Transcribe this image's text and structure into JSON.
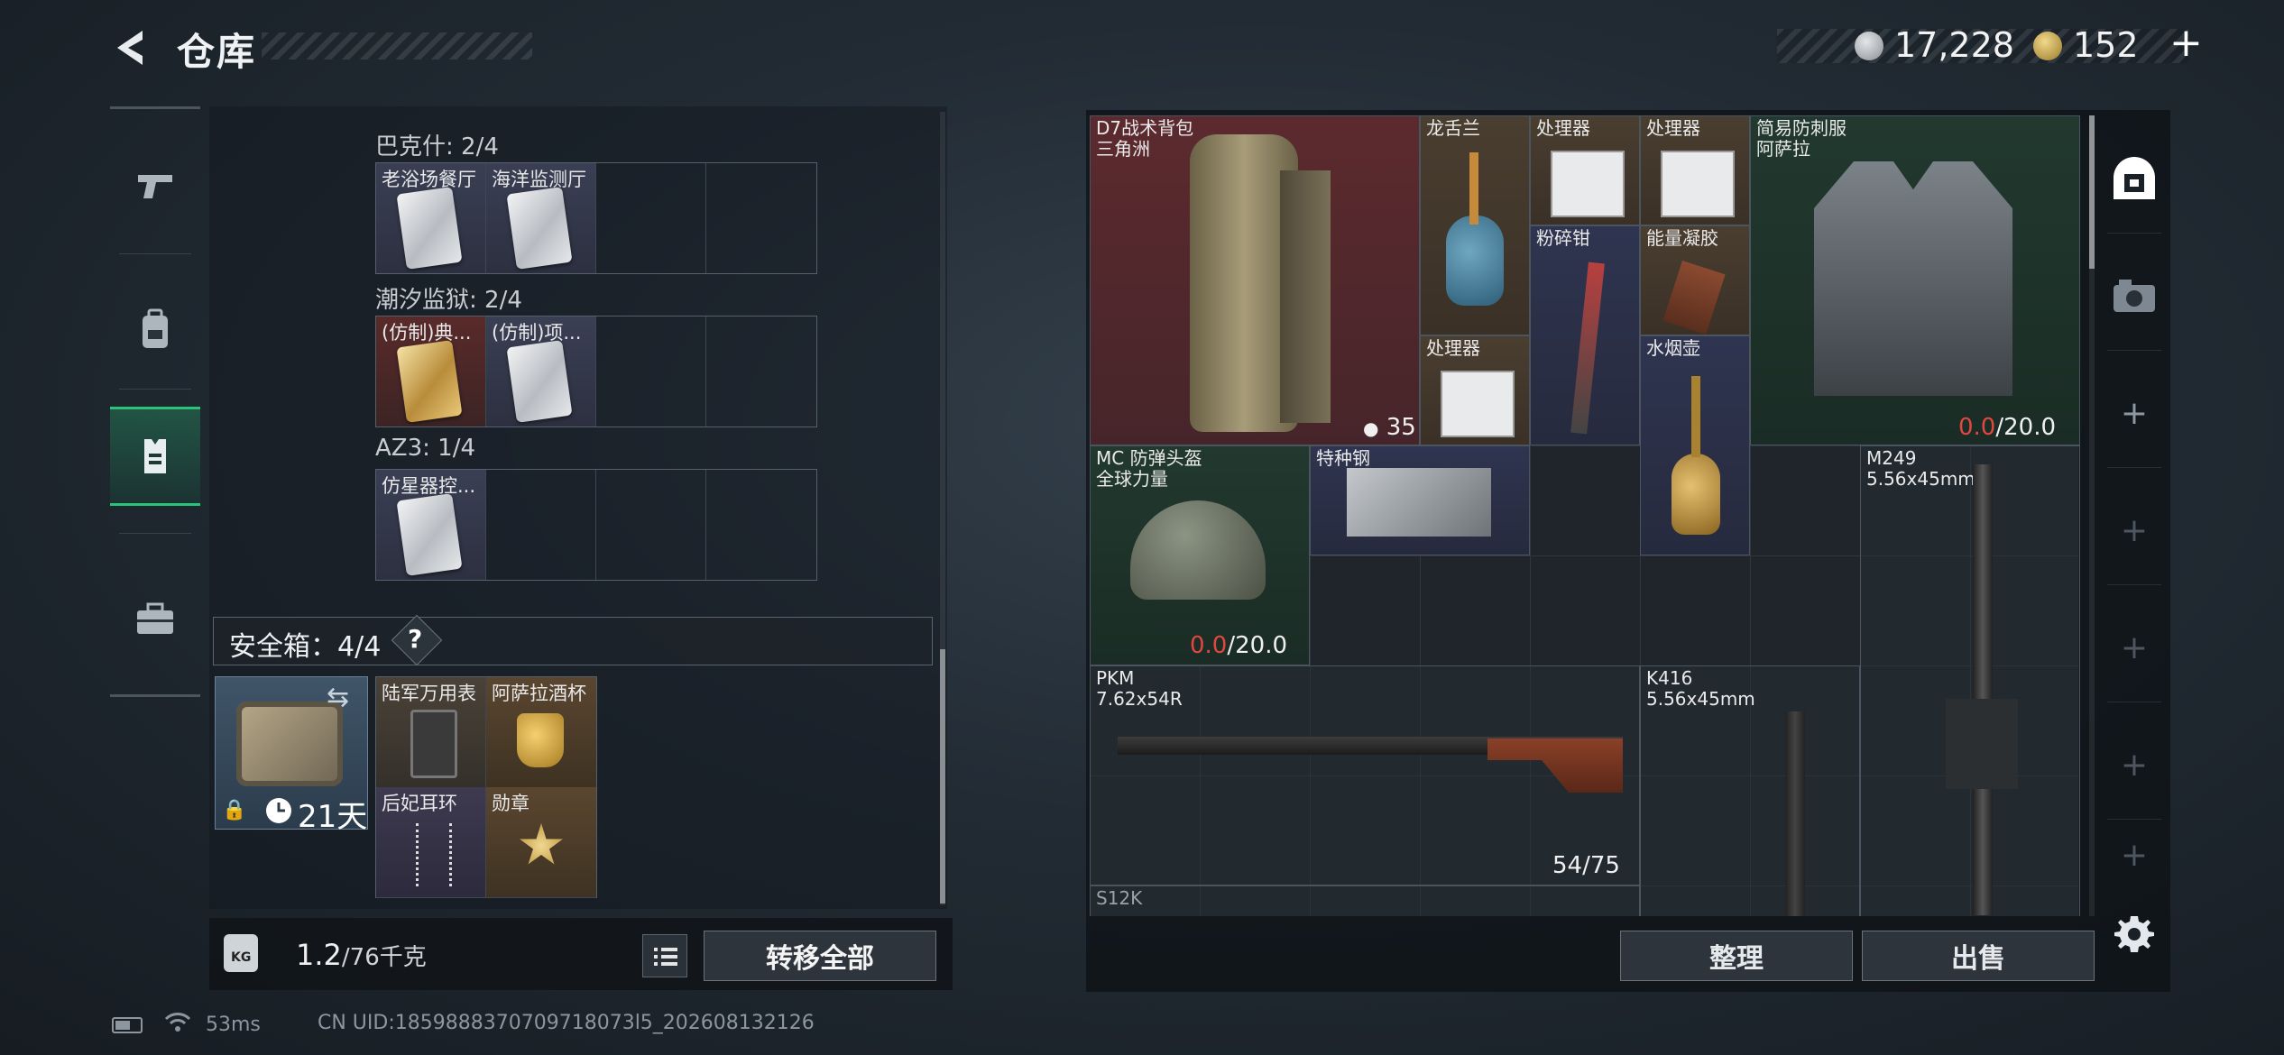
{
  "header": {
    "title": "仓库",
    "currency_silver": "17,228",
    "currency_gold": "152",
    "currency_plus": "+"
  },
  "nav": {
    "items": [
      {
        "icon": "pistol-icon"
      },
      {
        "icon": "backpack-icon"
      },
      {
        "icon": "vest-icon"
      },
      {
        "icon": "briefcase-icon"
      }
    ]
  },
  "collections": [
    {
      "label": "巴克什: 2/4",
      "items": [
        "老浴场餐厅",
        "海洋监测厅"
      ]
    },
    {
      "label": "潮汐监狱: 2/4",
      "items": [
        "(仿制)典...",
        "(仿制)项..."
      ]
    },
    {
      "label": "AZ3: 1/4",
      "items": [
        "仿星器控..."
      ]
    }
  ],
  "safe_box": {
    "label": "安全箱：4/4",
    "help": "?",
    "days": "21天",
    "items": [
      "陆军万用表",
      "阿萨拉酒杯",
      "后妃耳环",
      "勋章"
    ]
  },
  "weight": {
    "current": "1.2",
    "max": "/76千克",
    "kg_label": "KG"
  },
  "buttons": {
    "transfer_all": "转移全部",
    "sort": "整理",
    "sell": "出售"
  },
  "stash_items": {
    "backpack": {
      "name_line1": "D7战术背包",
      "name_line2": "三角洲",
      "count": "35"
    },
    "agave": {
      "name": "龙舌兰"
    },
    "processor1": {
      "name": "处理器"
    },
    "processor2": {
      "name": "处理器"
    },
    "processor3": {
      "name": "处理器"
    },
    "pliers": {
      "name": "粉碎钳"
    },
    "energy_gel": {
      "name": "能量凝胶"
    },
    "hookah": {
      "name": "水烟壶"
    },
    "armor": {
      "name_line1": "简易防刺服",
      "name_line2": "阿萨拉",
      "durability_cur": "0.0",
      "durability_max": "/20.0"
    },
    "helmet": {
      "name_line1": "MC 防弹头盔",
      "name_line2": "全球力量",
      "durability_cur": "0.0",
      "durability_max": "/20.0"
    },
    "steel": {
      "name": "特种钢"
    },
    "m249": {
      "name_line1": "M249",
      "name_line2": "5.56x45mm"
    },
    "pkm": {
      "name_line1": "PKM",
      "name_line2": "7.62x54R",
      "ammo": "54/75"
    },
    "k416": {
      "name_line1": "K416",
      "name_line2": "5.56x45mm"
    },
    "s12k": {
      "name": "S12K"
    }
  },
  "side_panel": {
    "icons": [
      "safe-icon",
      "camera-icon",
      "plus",
      "plus",
      "plus",
      "plus",
      "plus"
    ]
  },
  "status_bar": {
    "ping": "53ms",
    "uid": "CN UID:1859888370709718073l5_202608132126"
  }
}
